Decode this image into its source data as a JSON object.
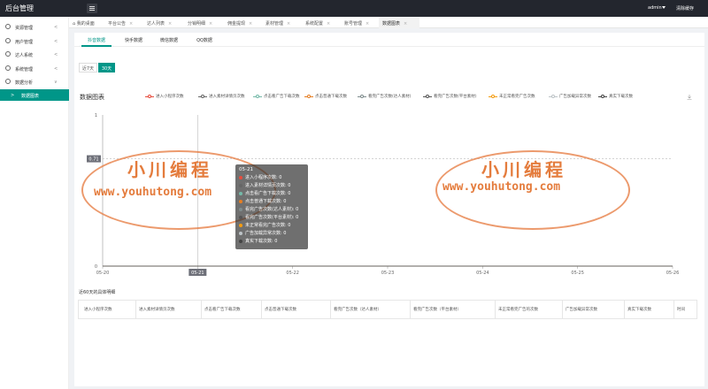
{
  "header": {
    "title": "后台管理",
    "user": "admin",
    "clear_cache": "清除缓存"
  },
  "sidebar": {
    "items": [
      {
        "label": "资源管理",
        "icon": "folder-icon"
      },
      {
        "label": "用户管理",
        "icon": "gear-icon"
      },
      {
        "label": "达人系统",
        "icon": "user-icon"
      },
      {
        "label": "系统管理",
        "icon": "settings-icon"
      },
      {
        "label": "数据分析",
        "icon": "chart-icon"
      }
    ],
    "sub_item": {
      "label": "数据图表",
      "arrow": ">"
    }
  },
  "tabs": [
    {
      "label": "我的桌面",
      "icon": "home-icon"
    },
    {
      "label": "平台公告"
    },
    {
      "label": "达人列表"
    },
    {
      "label": "分销明细"
    },
    {
      "label": "佣金提现"
    },
    {
      "label": "素材管理"
    },
    {
      "label": "系统配置"
    },
    {
      "label": "账号管理"
    },
    {
      "label": "数据图表",
      "active": true
    }
  ],
  "subtabs": [
    "抖音数据",
    "快手数据",
    "微信数据",
    "QQ数据"
  ],
  "range": [
    "近7天",
    "30天"
  ],
  "chart_section": {
    "title": "数据图表"
  },
  "chart_data": {
    "type": "line",
    "x": [
      "05-20",
      "05-21",
      "05-22",
      "05-23",
      "05-24",
      "05-25",
      "05-26"
    ],
    "ylim": [
      0,
      1
    ],
    "y_ticks": [
      "0",
      "1"
    ],
    "marker_line_label": "0.71",
    "hover_x": "05-21",
    "series": [
      {
        "name": "进入小程序次数",
        "color": "#e74c3c",
        "values": [
          0,
          0,
          0,
          0,
          0,
          0,
          0
        ]
      },
      {
        "name": "进入素材详情页次数",
        "color": "#666666",
        "values": [
          0,
          0,
          0,
          0,
          0,
          0,
          0
        ]
      },
      {
        "name": "点击看广告下载次数",
        "color": "#74b9a8",
        "values": [
          0,
          0,
          0,
          0,
          0,
          0,
          0
        ]
      },
      {
        "name": "点击普通下载次数",
        "color": "#e67e22",
        "values": [
          0,
          0,
          0,
          0,
          0,
          0,
          0
        ]
      },
      {
        "name": "看完广告次数(达人素材)",
        "color": "#7f8c8d",
        "values": [
          0,
          0,
          0,
          0,
          0,
          0,
          0
        ]
      },
      {
        "name": "看完广告次数(平台素材)",
        "color": "#555555",
        "values": [
          0,
          0,
          0,
          0,
          0,
          0,
          0
        ]
      },
      {
        "name": "未正常看完广告次数",
        "color": "#f39c12",
        "values": [
          0,
          0,
          0,
          0,
          0,
          0,
          0
        ]
      },
      {
        "name": "广告加载异常次数",
        "color": "#bdc3c7",
        "values": [
          0,
          0,
          0,
          0,
          0,
          0,
          0
        ]
      },
      {
        "name": "真实下载次数",
        "color": "#444444",
        "values": [
          0,
          0,
          0,
          0,
          0,
          0,
          0
        ]
      }
    ]
  },
  "tooltip": {
    "date": "05-21",
    "rows": [
      {
        "label": "进入小程序次数: 0",
        "color": "#e74c3c"
      },
      {
        "label": "进入素材详情页次数: 0",
        "color": "#666666"
      },
      {
        "label": "点击看广告下载次数: 0",
        "color": "#74b9a8"
      },
      {
        "label": "点击普通下载次数: 0",
        "color": "#e67e22"
      },
      {
        "label": "看完广告次数(达人素材): 0",
        "color": "#7f8c8d"
      },
      {
        "label": "看完广告次数(平台素材): 0",
        "color": "#555555"
      },
      {
        "label": "未正常看完广告次数: 0",
        "color": "#f39c12"
      },
      {
        "label": "广告加载异常次数: 0",
        "color": "#bdc3c7"
      },
      {
        "label": "真实下载次数: 0",
        "color": "#444444"
      }
    ]
  },
  "table": {
    "caption": "近60天的具体明细",
    "headers": [
      "进入小程序次数",
      "进入素材详情页次数",
      "点击看广告下载次数",
      "点击普通下载次数",
      "看完广告次数（达人素材）",
      "看完广告次数（平台素材）",
      "未正常看完广告的次数",
      "广告加载异常次数",
      "真实下载次数",
      "时间"
    ]
  },
  "watermark": {
    "cn": "小川编程",
    "en": "www.youhutong.com"
  },
  "colors": {
    "accent": "#009688",
    "topbar": "#23262e"
  }
}
